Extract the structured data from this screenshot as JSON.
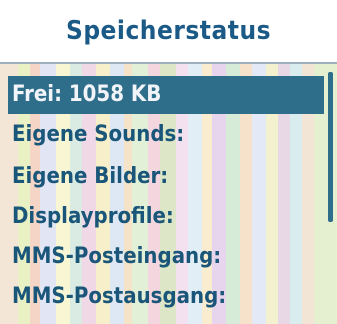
{
  "header": {
    "title": "Speicherstatus"
  },
  "menu": {
    "items": [
      {
        "label": "Frei: 1058 KB",
        "selected": true
      },
      {
        "label": "Eigene Sounds:"
      },
      {
        "label": "Eigene Bilder:"
      },
      {
        "label": "Displayprofile:"
      },
      {
        "label": "MMS-Posteingang:"
      },
      {
        "label": "MMS-Postausgang:"
      }
    ]
  },
  "colors": {
    "title_text": "#1b5a86",
    "selection_bg": "#2f6e8a",
    "selection_text": "#f1f4f8",
    "item_text": "#1a5679"
  }
}
